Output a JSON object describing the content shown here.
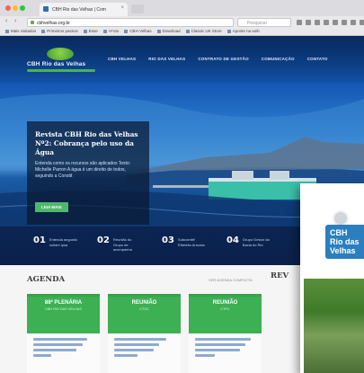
{
  "browser": {
    "tab_title": "CBH Rio das Velhas | Com",
    "tab_close": "×",
    "address": "cbhvelhas.org.br",
    "search_placeholder": "Pesquisar",
    "back_glyph": "‹",
    "forward_glyph": "›",
    "bookmarks": [
      "Mais visitados",
      "Primeiros passos",
      "Esse",
      "i-Foto",
      "CBH Velhas",
      "Download",
      "Classic UK Store",
      "Aponte na web"
    ],
    "colors": {
      "close": "#ff5f57",
      "minimize": "#febc2e",
      "maximize": "#28c840"
    }
  },
  "site": {
    "logo_text": "CBH Rio das Velhas",
    "nav": [
      "CBH VELHAS",
      "RIO DAS VELHAS",
      "CONTRATO DE GESTÃO",
      "COMUNICAÇÃO",
      "CONTATO"
    ],
    "feature": {
      "title": "Revista CBH Rio das Velhas Nº2: Cobrança pelo uso da Água",
      "text": "Entenda como os recursos são aplicados Texto: Michelle Parron A água é um direito de todos, seguindo a Constit",
      "button": "LEIA MAIS"
    },
    "steps": [
      {
        "num": "01",
        "label": "Entenda angustio nullam ipsa"
      },
      {
        "num": "02",
        "label": "Reunião do Grupo de acompanha"
      },
      {
        "num": "03",
        "label": "Subcomitê Ribeirão Arrudas"
      },
      {
        "num": "04",
        "label": "Grupo Gestor da Bacia do Rio"
      }
    ],
    "agenda": {
      "title": "AGENDA",
      "see_all": "VER AGENDA COMPLETA",
      "cards": [
        {
          "heading": "88ª PLENÁRIA",
          "sub": "CBH RIO DAS VELHAS"
        },
        {
          "heading": "REUNIÃO",
          "sub": "CTOC"
        },
        {
          "heading": "REUNIÃO",
          "sub": "CTPC"
        }
      ]
    },
    "revista_title": "REV",
    "magazine": {
      "logo_line1": "CBH",
      "logo_line2": "Rio das",
      "logo_line3": "Velhas"
    },
    "colors": {
      "accent_green": "#3cb052",
      "hero_blue": "#1559b5"
    }
  }
}
